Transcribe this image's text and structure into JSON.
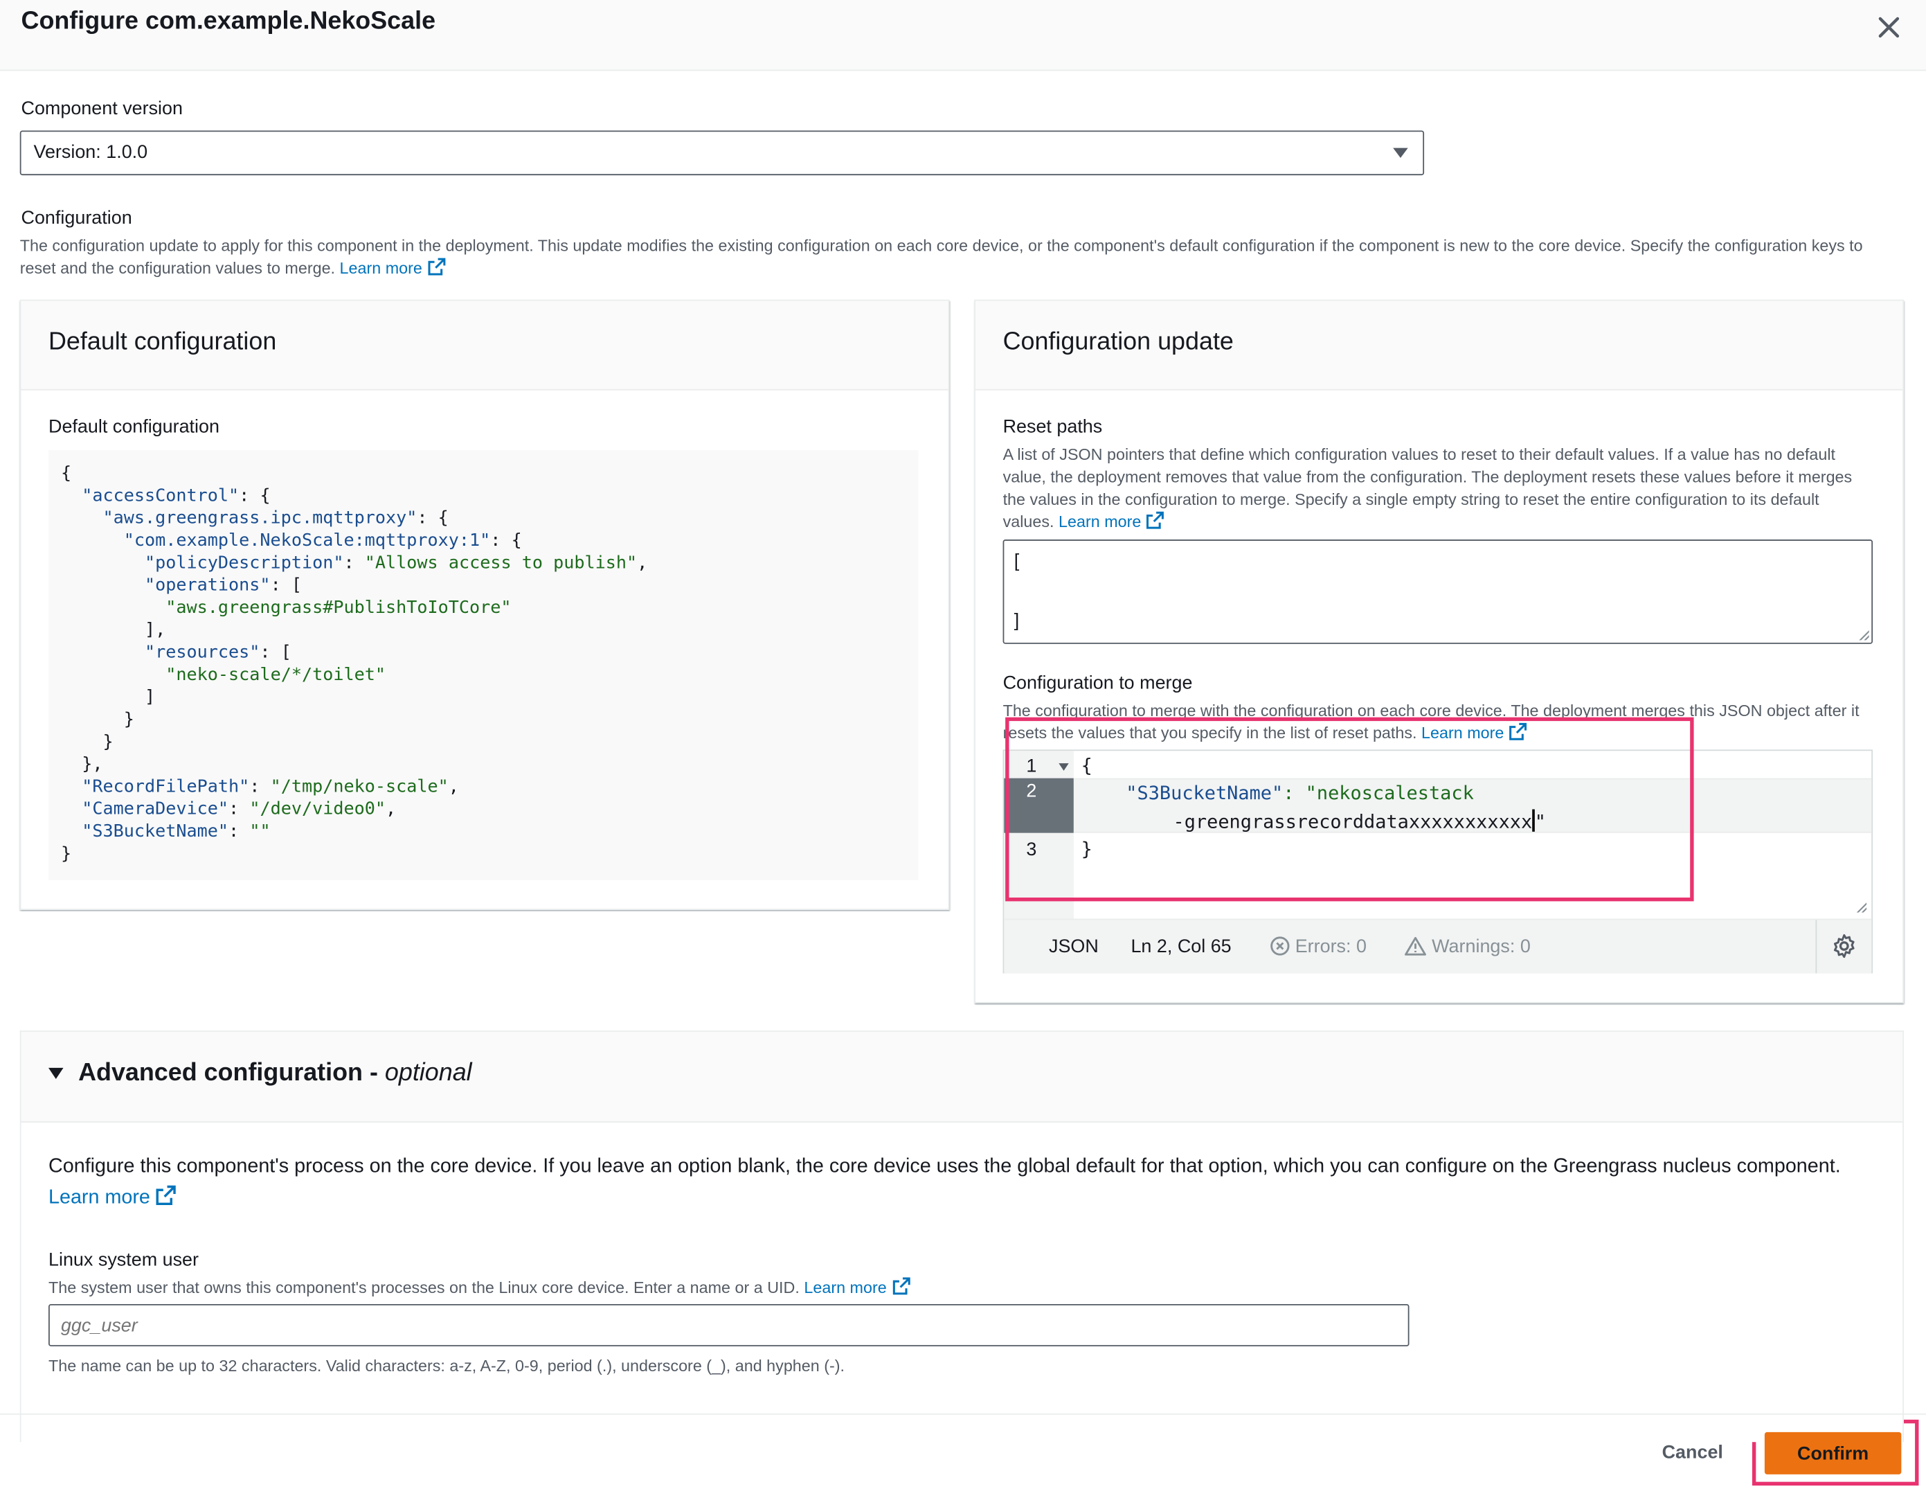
{
  "modal": {
    "title": "Configure com.example.NekoScale"
  },
  "component_version": {
    "label": "Component version",
    "selected": "Version: 1.0.0"
  },
  "configuration": {
    "label": "Configuration",
    "description": "The configuration update to apply for this component in the deployment. This update modifies the existing configuration on each core device, or the component's default configuration if the component is new to the core device. Specify the configuration keys to reset and the configuration values to merge.",
    "learn_more": "Learn more"
  },
  "default_panel": {
    "header": "Default configuration",
    "field_label": "Default configuration",
    "code_lines": [
      "{",
      "  \"accessControl\": {",
      "    \"aws.greengrass.ipc.mqttproxy\": {",
      "      \"com.example.NekoScale:mqttproxy:1\": {",
      "        \"policyDescription\": \"Allows access to publish\",",
      "        \"operations\": [",
      "          \"aws.greengrass#PublishToIoTCore\"",
      "        ],",
      "        \"resources\": [",
      "          \"neko-scale/*/toilet\"",
      "        ]",
      "      }",
      "    }",
      "  },",
      "  \"RecordFilePath\": \"/tmp/neko-scale\",",
      "  \"CameraDevice\": \"/dev/video0\",",
      "  \"S3BucketName\": \"\"",
      "}"
    ]
  },
  "update_panel": {
    "header": "Configuration update",
    "reset_paths": {
      "label": "Reset paths",
      "description": "A list of JSON pointers that define which configuration values to reset to their default values. If a value has no default value, the deployment removes that value from the configuration. The deployment resets these values before it merges the values in the configuration to merge. Specify a single empty string to reset the entire configuration to its default values.",
      "learn_more": "Learn more",
      "line1": "[",
      "line2": "]"
    },
    "merge": {
      "label": "Configuration to merge",
      "description": "The configuration to merge with the configuration on each core device. The deployment merges this JSON object after it resets the values that you specify in the list of reset paths.",
      "learn_more": "Learn more",
      "line_numbers": [
        "1",
        "2",
        "3"
      ],
      "line1": "{",
      "line2a_key": "\"S3BucketName\"",
      "line2a_rest": ": \"nekoscalestack",
      "line2b": "-greengrassrecorddataxxxxxxxxxxx",
      "line2b_end": "\"",
      "line3": "}"
    },
    "status": {
      "language": "JSON",
      "position": "Ln 2, Col 65",
      "errors": "Errors: 0",
      "warnings": "Warnings: 0"
    }
  },
  "advanced": {
    "title": "Advanced configuration -",
    "title_optional": "optional",
    "description": "Configure this component's process on the core device. If you leave an option blank, the core device uses the global default for that option, which you can configure on the Greengrass nucleus component.",
    "learn_more": "Learn more",
    "linux_user": {
      "label": "Linux system user",
      "description": "The system user that owns this component's processes on the Linux core device. Enter a name or a UID.",
      "learn_more": "Learn more",
      "placeholder": "ggc_user",
      "constraint": "The name can be up to 32 characters. Valid characters: a-z, A-Z, 0-9, period (.), underscore (_), and hyphen (-)."
    }
  },
  "footer": {
    "cancel": "Cancel",
    "confirm": "Confirm"
  },
  "colors": {
    "primary_button": "#ec7211",
    "link": "#0073bb",
    "highlight_box": "#e8336f"
  },
  "icons": [
    "close-icon",
    "caret-down-icon",
    "external-link-icon",
    "fold-caret-icon",
    "error-circle-icon",
    "warning-triangle-icon",
    "gear-icon",
    "expand-triangle-icon"
  ]
}
